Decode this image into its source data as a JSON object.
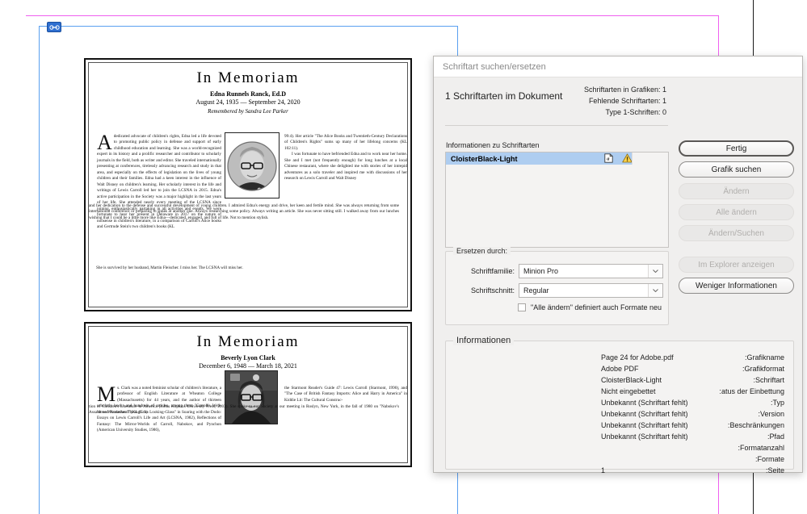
{
  "canvas": {
    "link_badge_icon": "link-chain-icon",
    "guide_color": "#5aa0f0",
    "margin_guide_color": "#f060f0",
    "page_edge_color": "#1a1a1a"
  },
  "articles": [
    {
      "title": "In  Memoriam",
      "name": "Edna Runnels Ranck, Ed.D",
      "dates": "August 24, 1935 — September 24, 2020",
      "remembered_by": "Remembered by Sandra Lee Parker",
      "dropcap": "A",
      "col_left": "dedicated advocate of children's rights, Edna led a life devoted to promoting public policy in defense and support of early childhood education and learning. She was a world-recognized expert in its history and a prolific researcher and contributor to scholarly journals in the field, both as writer and editor. She traveled internationally presenting at conferences, tirelessly advancing research and study in that area, and especially on the effects of legislation on the lives of young children and their families. Edna had a keen interest in the influence of Walt Disney on children's learning. Her scholarly interest in the life and writings of Lewis Carroll led her to join the LCSNA in 2015. Edna's active participation in the Society was a major highlight in the last years of her life. She attended nearly every meeting of the LCSNA since joining, enthusiastically partaking in all activities and events. We were fortunate to hear her present in Delaware in 2017 on the nature of nonsense in children's literature, in a comparison of Carroll's Alice books and Gertrude Stein's two children's books (KL",
      "col_right": "99:4). Her article \"The Alice Books and Twentieth-Century Declarations of Children's Rights\" sums up many of her lifelong concerns (KL 102:11).",
      "col_right2": "I was fortunate to have befriended Edna and to work near her home. She and I met (not frequently enough) for long lunches at a local Chinese restaurant, where she delighted me with stories of her intrepid adventures as a solo traveler and inspired me with discussions of her research on Lewis Carroll and Walt Disney",
      "full_text": "and her dedication to the defense and successful development of young children. I admired Edna's energy and drive, her keen and fertile mind. She was always returning from some international conference or preparing to speak at another one. Always researching some policy. Always writing an article. She was never sitting still. I walked away from our lunches wishing that I could be a little more like Edna—dedicated, engaged, and full of life. Not to mention stylish.",
      "closing": "She is survived by her husband, Martin Fleischer. I miss her. The LCSNA will miss her.",
      "photo_alt": "portrait-edna-runnels-ranck"
    },
    {
      "title": "In  Memoriam",
      "name": "Beverly Lyon Clark",
      "dates": "December 6, 1948 — March 18, 2021",
      "dropcap": "M",
      "col_left": "s. Clark was a noted feminist scholar of children's literature, a professor of English Literature at Wheaton College (Massachusetts) for 44 years, and the author of thirteen scholarly books and hundreds of articles, among them \"Carroll's Well-Versed Narrative: Through the Looking-Glass\" in Soaring with the Dodo: Essays on Lewis Carroll's Life and Art (LCSNA, 1982), Reflections of Fantasy: The Mirror-Worlds of Carroll, Nabokov, and Pynchon (American University Studies, 1986),",
      "col_right": "the Starmont Reader's Guide 47: Lewis Carroll (Starmont, 1990), and \"The Case of British Fantasy Imports: Alice and Harry in America\" in Kiddie Lit: The Cultural Construc-",
      "full_text": "tion of Children's Literature in America (Johns Hopkins University Press, 2003). She spoke to our Society at our meeting in Roslyn, New York, in the fall of 1980 on \"Nabokov's Assault on Wonderland\" (KL 15:1).",
      "photo_alt": "portrait-beverly-lyon-clark"
    }
  ],
  "dialog": {
    "title": "Schriftart suchen/ersetzen",
    "summary_heading": "1 Schriftarten im Dokument",
    "stats": [
      "Schriftarten in Grafiken: 1",
      "Fehlende Schriftarten: 1",
      "Type 1-Schriften: 0"
    ],
    "list_label": "Informationen zu Schriftarten",
    "list_rows": [
      {
        "name": "CloisterBlack-Light",
        "icon_document": "document-a-icon",
        "icon_warning": "warning-triangle-icon"
      }
    ],
    "replace_group": {
      "legend": "Ersetzen durch:",
      "family_label": "Schriftfamilie:",
      "family_value": "Minion Pro",
      "style_label": "Schriftschnitt:",
      "style_value": "Regular",
      "checkbox_label": "\"Alle ändern\" definiert auch Formate neu",
      "checkbox_checked": false
    },
    "buttons": [
      {
        "label": "Fertig",
        "state": "default"
      },
      {
        "label": "Grafik suchen",
        "state": "enabled"
      },
      {
        "label": "Ändern",
        "state": "disabled"
      },
      {
        "label": "Alle ändern",
        "state": "disabled"
      },
      {
        "label": "Ändern/Suchen",
        "state": "disabled"
      },
      {
        "label": "Im Explorer anzeigen",
        "state": "disabled"
      },
      {
        "label": "Weniger Informationen",
        "state": "enabled"
      }
    ],
    "info_group": {
      "legend": "Informationen",
      "rows": [
        {
          "key": "Grafikname:",
          "value": "Page 24 for Adobe.pdf"
        },
        {
          "key": "Grafikformat:",
          "value": "Adobe PDF"
        },
        {
          "key": "Schriftart:",
          "value": "CloisterBlack-Light"
        },
        {
          "key": "atus der Einbettung:",
          "value": "Nicht eingebettet"
        },
        {
          "key": "Typ:",
          "value": "Unbekannt (Schriftart fehlt)"
        },
        {
          "key": "Version:",
          "value": "Unbekannt (Schriftart fehlt)"
        },
        {
          "key": "Beschränkungen:",
          "value": "Unbekannt (Schriftart fehlt)"
        },
        {
          "key": "Pfad:",
          "value": "Unbekannt (Schriftart fehlt)"
        },
        {
          "key": "Formatanzahl:",
          "value": ""
        },
        {
          "key": "Formate:",
          "value": ""
        },
        {
          "key": "Seite:",
          "value": "1"
        }
      ]
    }
  }
}
